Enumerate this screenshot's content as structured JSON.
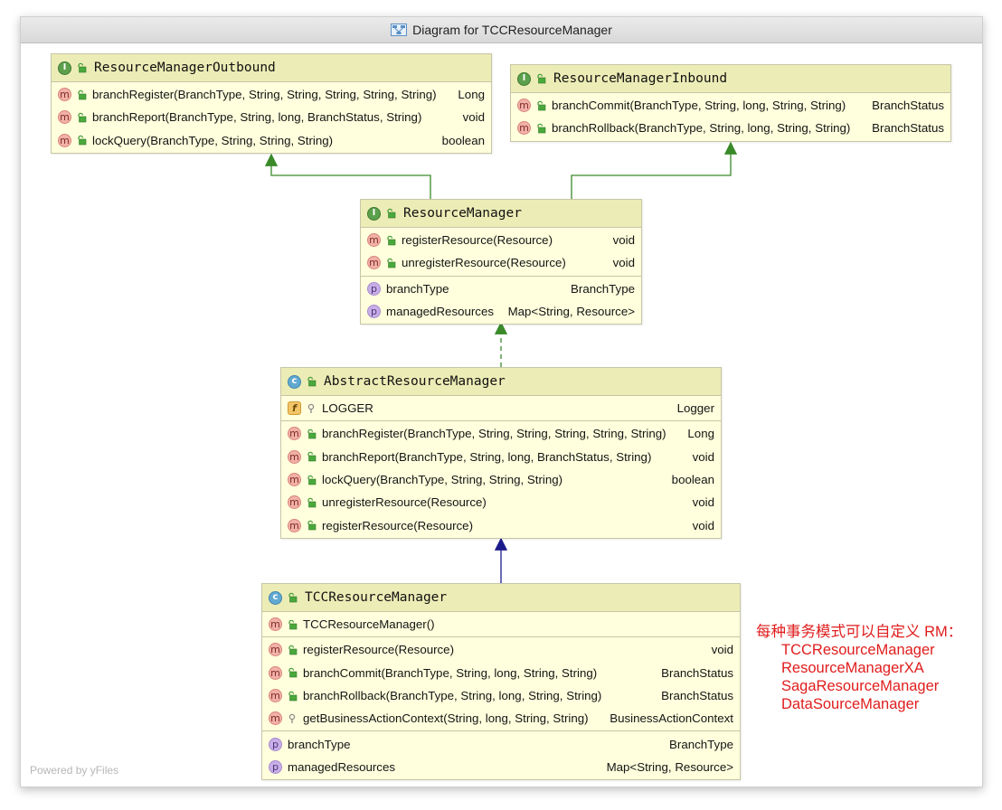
{
  "window": {
    "title": "Diagram for TCCResourceManager"
  },
  "classes": {
    "outbound": {
      "kind": "I",
      "name": "ResourceManagerOutbound",
      "sections": [
        [
          {
            "icon": "m",
            "vis": "public",
            "sig": "branchRegister(BranchType, String, String, String, String, String)",
            "type": "Long"
          },
          {
            "icon": "m",
            "vis": "public",
            "sig": "branchReport(BranchType, String, long, BranchStatus, String)",
            "type": "void"
          },
          {
            "icon": "m",
            "vis": "public",
            "sig": "lockQuery(BranchType, String, String, String)",
            "type": "boolean"
          }
        ]
      ]
    },
    "inbound": {
      "kind": "I",
      "name": "ResourceManagerInbound",
      "sections": [
        [
          {
            "icon": "m",
            "vis": "public",
            "sig": "branchCommit(BranchType, String, long, String, String)",
            "type": "BranchStatus"
          },
          {
            "icon": "m",
            "vis": "public",
            "sig": "branchRollback(BranchType, String, long, String, String)",
            "type": "BranchStatus"
          }
        ]
      ]
    },
    "resource_manager": {
      "kind": "I",
      "name": "ResourceManager",
      "sections": [
        [
          {
            "icon": "m",
            "vis": "public",
            "sig": "registerResource(Resource)",
            "type": "void"
          },
          {
            "icon": "m",
            "vis": "public",
            "sig": "unregisterResource(Resource)",
            "type": "void"
          }
        ],
        [
          {
            "icon": "p",
            "vis": "",
            "sig": "branchType",
            "type": "BranchType"
          },
          {
            "icon": "p",
            "vis": "",
            "sig": "managedResources",
            "type": "Map<String, Resource>"
          }
        ]
      ]
    },
    "abstract": {
      "kind": "C",
      "name": "AbstractResourceManager",
      "sections": [
        [
          {
            "icon": "f",
            "vis": "private",
            "sig": "LOGGER",
            "type": "Logger"
          }
        ],
        [
          {
            "icon": "m",
            "vis": "public",
            "sig": "branchRegister(BranchType, String, String, String, String, String)",
            "type": "Long"
          },
          {
            "icon": "m",
            "vis": "public",
            "sig": "branchReport(BranchType, String, long, BranchStatus, String)",
            "type": "void"
          },
          {
            "icon": "m",
            "vis": "public",
            "sig": "lockQuery(BranchType, String, String, String)",
            "type": "boolean"
          },
          {
            "icon": "m",
            "vis": "public",
            "sig": "unregisterResource(Resource)",
            "type": "void"
          },
          {
            "icon": "m",
            "vis": "public",
            "sig": "registerResource(Resource)",
            "type": "void"
          }
        ]
      ]
    },
    "tcc": {
      "kind": "C",
      "name": "TCCResourceManager",
      "sections": [
        [
          {
            "icon": "m",
            "vis": "public",
            "sig": "TCCResourceManager()",
            "type": ""
          }
        ],
        [
          {
            "icon": "m",
            "vis": "public",
            "sig": "registerResource(Resource)",
            "type": "void"
          },
          {
            "icon": "m",
            "vis": "public",
            "sig": "branchCommit(BranchType, String, long, String, String)",
            "type": "BranchStatus"
          },
          {
            "icon": "m",
            "vis": "public",
            "sig": "branchRollback(BranchType, String, long, String, String)",
            "type": "BranchStatus"
          },
          {
            "icon": "m",
            "vis": "private",
            "sig": "getBusinessActionContext(String, long, String, String)",
            "type": "BusinessActionContext"
          }
        ],
        [
          {
            "icon": "p",
            "vis": "",
            "sig": "branchType",
            "type": "BranchType"
          },
          {
            "icon": "p",
            "vis": "",
            "sig": "managedResources",
            "type": "Map<String, Resource>"
          }
        ]
      ]
    }
  },
  "annotation": {
    "heading": "每种事务模式可以自定义 RM：",
    "items": [
      "TCCResourceManager",
      "ResourceManagerXA",
      "SagaResourceManager",
      "DataSourceManager"
    ]
  },
  "watermark": "Powered by yFiles",
  "colors": {
    "interface_arrow": "#3a8a2a",
    "class_arrow": "#1a1a8c",
    "note_text": "#e01d1d",
    "box_fill": "#ffffdd",
    "box_header": "#ececb6"
  }
}
